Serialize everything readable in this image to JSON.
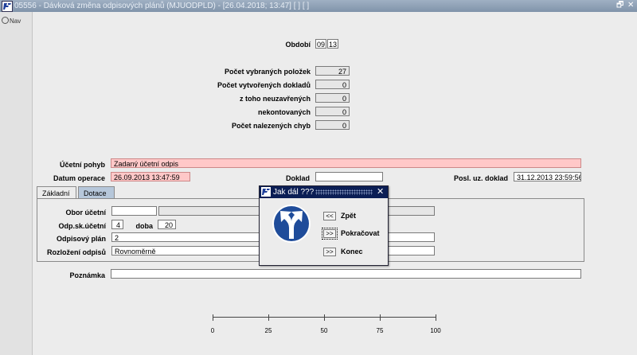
{
  "window": {
    "title": "05556 - Dávková změna odpisových plánů (MJUODPLD) - [26.04.2018; 13:47]  [ ] [ ]",
    "restore_glyph": "🗗",
    "close_glyph": "✕",
    "logo_icon": "app-logo-icon"
  },
  "nav": {
    "label": "Nav",
    "icon": "globe-icon"
  },
  "obdobi": {
    "label": "Období",
    "month": "09",
    "year": "13"
  },
  "counters": [
    {
      "label": "Počet vybraných položek",
      "value": "27"
    },
    {
      "label": "Počet vytvořených dokladů",
      "value": "0"
    },
    {
      "label": "z toho  neuzavřených",
      "value": "0"
    },
    {
      "label": "nekontovaných",
      "value": "0"
    },
    {
      "label": "Počet nalezených chyb",
      "value": "0"
    }
  ],
  "ucetni_pohyb": {
    "label": "Účetní pohyb",
    "value": "Zadaný účetní odpis"
  },
  "datum_operace": {
    "label": "Datum operace",
    "value": "26.09.2013 13:47:59"
  },
  "doklad": {
    "label": "Doklad",
    "value": ""
  },
  "posl_uz_doklad": {
    "label": "Posl. uz. doklad",
    "value": "31.12.2013 23:59:56"
  },
  "tabs": [
    {
      "label": "Základní"
    },
    {
      "label": "Dotace"
    }
  ],
  "form": {
    "obor_label": "Obor účetní",
    "obor_value": "",
    "obor_name": "",
    "odp_sk_label": "Odp.sk.účetní",
    "odp_sk_value": "4",
    "doba_label": "doba",
    "doba_value": "20",
    "plan_label": "Odpisový plán",
    "plan_value": "2",
    "rozlozeni_label": "Rozložení odpisů",
    "rozlozeni_value": "Rovnoměrně"
  },
  "poznamka": {
    "label": "Poznámka",
    "value": ""
  },
  "progress": {
    "ticks": [
      "0",
      "25",
      "50",
      "75",
      "100"
    ],
    "value": 0
  },
  "dialog": {
    "title": "Jak dál ???",
    "close_glyph": "✕",
    "icon": "fork-arrow-icon",
    "buttons": [
      {
        "glyph": "<<",
        "label": "Zpět"
      },
      {
        "glyph": ">>",
        "label": "Pokračovat"
      },
      {
        "glyph": ">>",
        "label": "Konec"
      }
    ],
    "colors": {
      "titlebar": "#0b1e55",
      "icon_bg": "#1f4c9a"
    }
  }
}
